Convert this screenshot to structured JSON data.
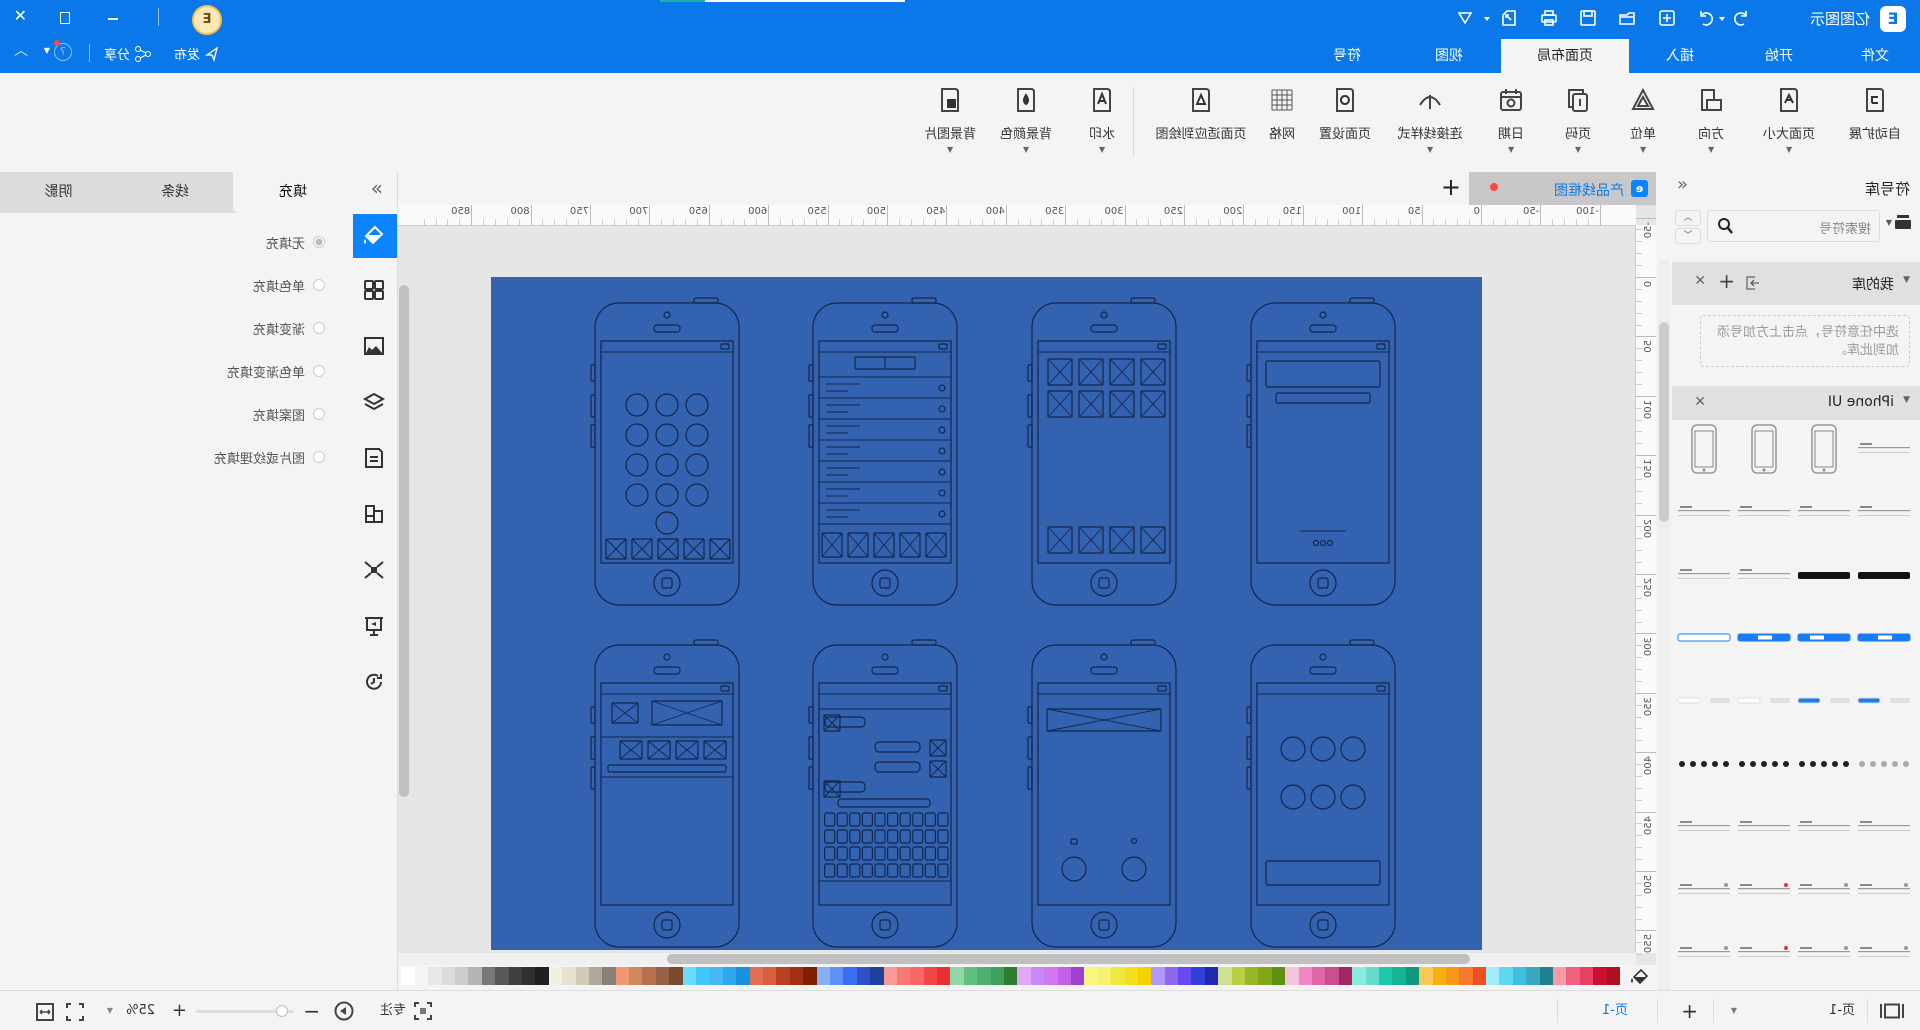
{
  "app": {
    "title": "亿图图示",
    "logo_letter": "E",
    "brand_color": "#0a78e8"
  },
  "titlebar": {
    "publish": "发布",
    "share": "分享"
  },
  "tabs": [
    {
      "label": "文件"
    },
    {
      "label": "开始"
    },
    {
      "label": "插入"
    },
    {
      "label": "页面布局",
      "active": true
    },
    {
      "label": "视图"
    },
    {
      "label": "符号"
    }
  ],
  "ribbon": [
    {
      "label": "自动扩展",
      "icon": "auto-expand-icon",
      "dropdown": false
    },
    {
      "label": "页面大小",
      "icon": "page-size-icon",
      "dropdown": true
    },
    {
      "label": "方向",
      "icon": "orientation-icon",
      "dropdown": true
    },
    {
      "label": "单位",
      "icon": "unit-icon",
      "dropdown": true
    },
    {
      "label": "页码",
      "icon": "page-number-icon",
      "dropdown": true
    },
    {
      "label": "日期",
      "icon": "date-icon",
      "dropdown": true
    },
    {
      "label": "连接线样式",
      "icon": "connector-style-icon",
      "dropdown": true
    },
    {
      "label": "页面设置",
      "icon": "page-setup-icon",
      "dropdown": false
    },
    {
      "label": "网格",
      "icon": "grid-icon",
      "dropdown": false
    },
    {
      "label": "页面适应到绘图",
      "icon": "fit-page-icon",
      "dropdown": false
    },
    {
      "label": "水印",
      "icon": "watermark-icon",
      "dropdown": true
    },
    {
      "label": "背景颜色",
      "icon": "background-color-icon",
      "dropdown": true
    },
    {
      "label": "背景图片",
      "icon": "background-image-icon",
      "dropdown": true
    }
  ],
  "symbol_panel": {
    "title": "符号库",
    "search_placeholder": "搜索符号",
    "my_library": "我的库",
    "my_library_hint": "选中任意符号，点击上方加号添加到此库。",
    "library": "iPhone UI"
  },
  "doc_tab": {
    "name": "产品线框图"
  },
  "ruler": {
    "horizontal": [
      "-100",
      "-50",
      "0",
      "50",
      "100",
      "150",
      "200",
      "250",
      "300",
      "350",
      "400",
      "450",
      "500",
      "550",
      "600",
      "650",
      "700",
      "750",
      "800",
      "850"
    ],
    "vertical": [
      "-50",
      "0",
      "50",
      "100",
      "150",
      "200",
      "250",
      "300",
      "350",
      "400",
      "450",
      "500",
      "550"
    ]
  },
  "fill_panel": {
    "tabs": [
      "填充",
      "线条",
      "阴影"
    ],
    "options": [
      "无填充",
      "单色填充",
      "渐变填充",
      "单色渐变填充",
      "图案填充",
      "图片或纹理填充"
    ],
    "selected": 0
  },
  "status": {
    "page_selector": "页-1",
    "active_page": "页-1",
    "focus": "专注",
    "zoom": "25%",
    "zoom_slider_fraction": 0.06
  },
  "colors": {
    "page_background": "#3262b0",
    "wireframe_line": "#14264a",
    "active_accent": "#0a84ff"
  },
  "palette": [
    "#b01020",
    "#c81030",
    "#e84060",
    "#f06080",
    "#f898a8",
    "#208090",
    "#38a8c0",
    "#40c0e0",
    "#60d8f0",
    "#a0ecf8",
    "#f05020",
    "#f87830",
    "#f89818",
    "#f8b010",
    "#f8c858",
    "#10987e",
    "#18b498",
    "#20c8b0",
    "#68dcc8",
    "#88ecdc",
    "#a02860",
    "#c85090",
    "#e068a8",
    "#f088c8",
    "#f4c4dc",
    "#609010",
    "#80a818",
    "#98b828",
    "#b8d048",
    "#d0e090",
    "#2028b0",
    "#3040d8",
    "#6848f0",
    "#9068f0",
    "#b098f8",
    "#f8d000",
    "#f0e020",
    "#f0e840",
    "#f8f070",
    "#f8f880",
    "#a040d0",
    "#c060e8",
    "#d078f0",
    "#c888f8",
    "#e0a8f8",
    "#2e7d32",
    "#40a060",
    "#50b070",
    "#60c080",
    "#90d8a8",
    "#e83030",
    "#f04848",
    "#f86868",
    "#f87878",
    "#f89898",
    "#2040a0",
    "#3050c8",
    "#3870f0",
    "#6090f8",
    "#88b0f8",
    "#802000",
    "#a03010",
    "#b84020",
    "#d86040",
    "#e07050",
    "#1890e0",
    "#30a8f0",
    "#48b8f8",
    "#40c8f8",
    "#68dcf8",
    "#7a4a30",
    "#986048",
    "#b87050",
    "#d08860",
    "#f09870",
    "#8a8078",
    "#b0a898",
    "#d0ccb8",
    "#e8e0d0",
    "#f4f0e0",
    "#202020",
    "#303030",
    "#404040",
    "#585858",
    "#787878",
    "#b4b4b4",
    "#cccccc",
    "#dcdcdc",
    "#e8e8e8",
    "#f4f4f4",
    "#ffffff"
  ]
}
